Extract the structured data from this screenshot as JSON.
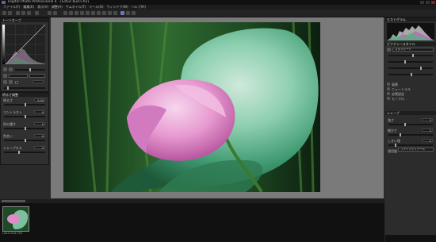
{
  "window": {
    "title": "Digital Photo Professional 4 - [Lotus bud.CR2]"
  },
  "menu": [
    "ファイル(F)",
    "編集(E)",
    "表示(V)",
    "調整(A)",
    "サムネイル(T)",
    "ツール(O)",
    "ウィンドウ(W)",
    "ヘルプ(H)"
  ],
  "left": {
    "tone_panel_title": "トーンカーブ",
    "adj_panel_title": "明るさ調整",
    "labels": [
      "明るさ",
      "コントラスト",
      "色の濃さ",
      "色合い",
      "シャープネス"
    ],
    "values": [
      "0.00",
      "0",
      "0",
      "0",
      "3"
    ]
  },
  "right": {
    "histogram_title": "ヒストグラム",
    "picture_style_title": "ピクチャースタイル",
    "style_value": "スタンダード",
    "options": [
      "風景",
      "ニュートラル",
      "忠実設定",
      "モノクロ"
    ],
    "sharp_title": "シャープ",
    "sharp_labels": [
      "強さ",
      "細かさ",
      "しきい値",
      "適用量"
    ],
    "sharp_values": [
      "3",
      "2",
      "1"
    ],
    "bottom_label": "ファインディテール"
  },
  "filmstrip": {
    "thumb_name": "Lotus bud.CR2"
  },
  "colors": {
    "bg": "#2a2a2a",
    "canvas": "#7a7a7a",
    "accent": "#f0f0f0"
  }
}
